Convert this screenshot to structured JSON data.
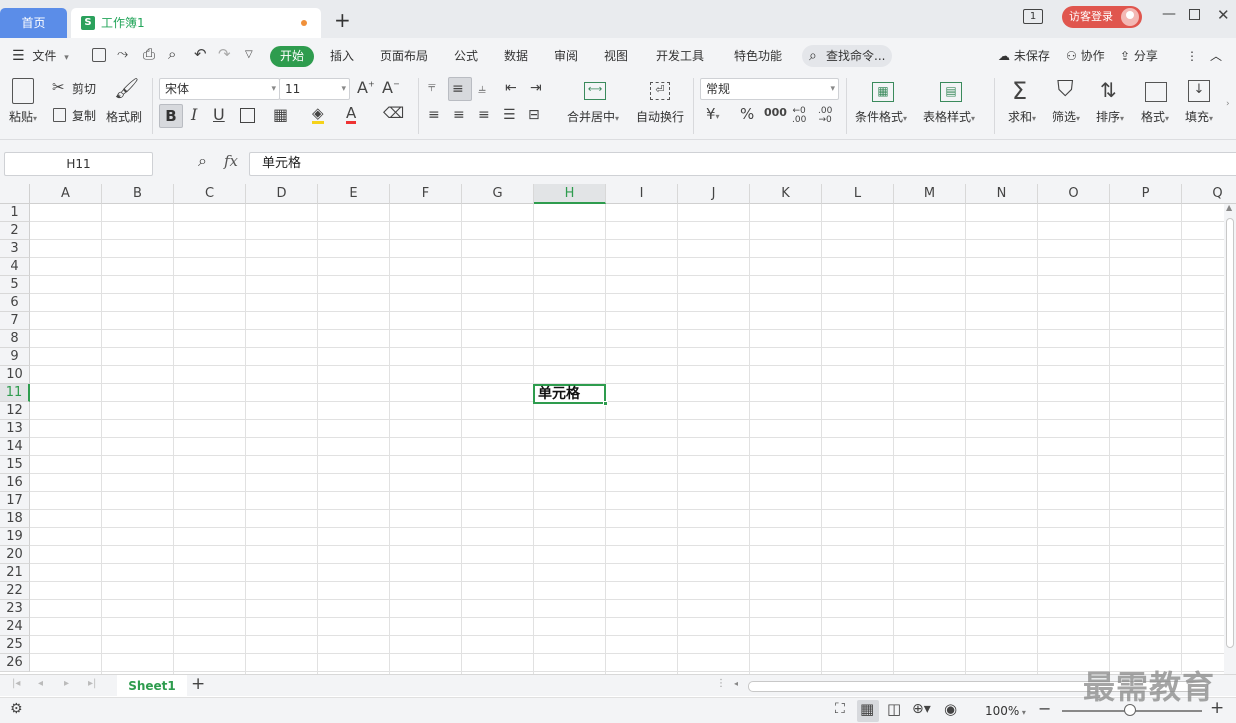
{
  "titlebar": {
    "home_tab": "首页",
    "doc_tab": "工作簿1",
    "doc_icon": "S",
    "new_tab": "+",
    "login_button": "访客登录",
    "page_indicator": "1"
  },
  "menu": {
    "file": "文件",
    "items": [
      "开始",
      "插入",
      "页面布局",
      "公式",
      "数据",
      "审阅",
      "视图",
      "开发工具",
      "特色功能"
    ],
    "search": "查找命令...",
    "unsaved": "未保存",
    "collab": "协作",
    "share": "分享"
  },
  "ribbon": {
    "paste": "粘贴",
    "cut": "剪切",
    "copy": "复制",
    "format_painter": "格式刷",
    "font_name": "宋体",
    "font_size": "11",
    "merge_center": "合并居中",
    "wrap_text": "自动换行",
    "number_format": "常规",
    "conditional_format": "条件格式",
    "table_style": "表格样式",
    "sum": "求和",
    "filter": "筛选",
    "sort": "排序",
    "format": "格式",
    "fill": "填充",
    "bold": "B",
    "italic": "I",
    "underline": "U",
    "percent": "%",
    "currency": "¥"
  },
  "formula": {
    "name_box": "H11",
    "fx": "fx",
    "content": "单元格"
  },
  "grid": {
    "columns": [
      "A",
      "B",
      "C",
      "D",
      "E",
      "F",
      "G",
      "H",
      "I",
      "J",
      "K",
      "L",
      "M",
      "N",
      "O",
      "P",
      "Q"
    ],
    "rows": [
      "1",
      "2",
      "3",
      "4",
      "5",
      "6",
      "7",
      "8",
      "9",
      "10",
      "11",
      "12",
      "13",
      "14",
      "15",
      "16",
      "17",
      "18",
      "19",
      "20",
      "21",
      "22",
      "23",
      "24",
      "25",
      "26"
    ],
    "selected_column": "H",
    "selected_row": "11",
    "selected_cell_value": "单元格"
  },
  "sheets": {
    "tabs": [
      "Sheet1"
    ],
    "add": "+"
  },
  "status": {
    "zoom": "100%"
  },
  "watermark": "最需教育",
  "colors": {
    "accent": "#2e9c4e",
    "home_tab": "#5b8de8",
    "login": "#e0564e"
  }
}
